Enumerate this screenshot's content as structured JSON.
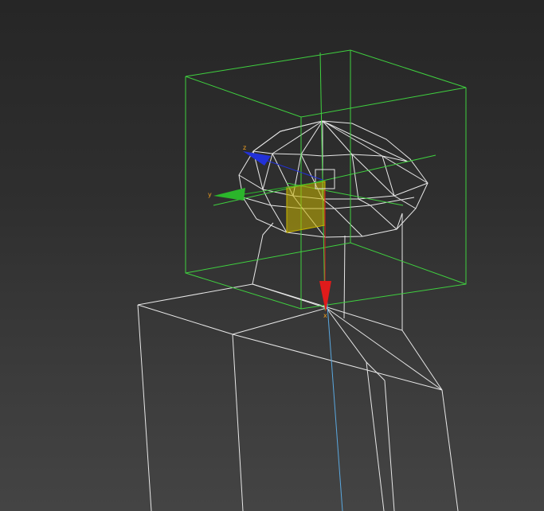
{
  "viewport": {
    "mode": "wireframe",
    "background": "#2f2f2f"
  },
  "colors": {
    "wire": "#e8e8e8",
    "selection_box": "#3fd13f",
    "axis_x": "#e01b1b",
    "axis_y": "#2bb52b",
    "axis_z": "#2231d8",
    "plane_handle": "#c8b400",
    "axis_label": "#f0a020",
    "pivot_line": "#5aa8e0"
  },
  "gizmo": {
    "type": "move",
    "labels": {
      "x": "x",
      "y": "y",
      "z": "z"
    },
    "icons": {
      "x": "arrow-down-red",
      "y": "arrow-left-green",
      "z": "arrow-left-blue",
      "plane": "xy-plane-square"
    }
  }
}
